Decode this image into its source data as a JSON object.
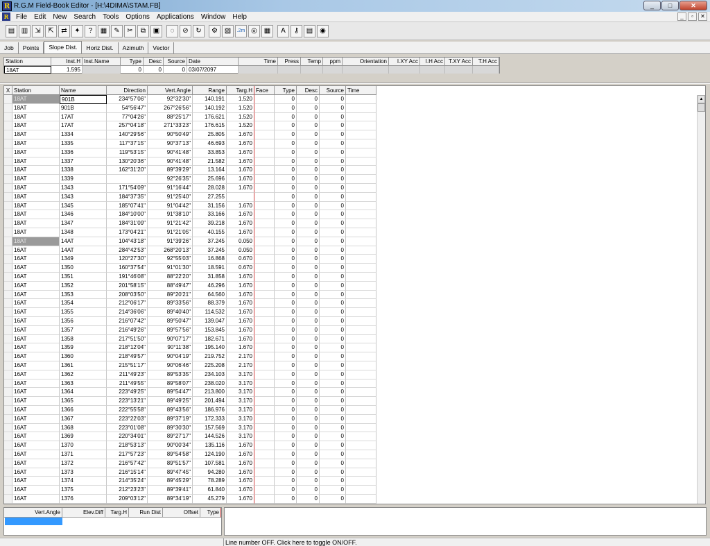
{
  "window": {
    "title": "R.G.M Field-Book Editor - [H:\\4DIMA\\STAM.FB]",
    "icon": "R",
    "min": "_",
    "max": "□",
    "close": "✕"
  },
  "menu": [
    "File",
    "Edit",
    "New",
    "Search",
    "Tools",
    "Options",
    "Applications",
    "Window",
    "Help"
  ],
  "mdi_controls": [
    "_",
    "▫",
    "✕"
  ],
  "toolbar": [
    {
      "name": "new-fieldbook-icon",
      "glyph": "▤"
    },
    {
      "name": "open-icon",
      "glyph": "▥"
    },
    {
      "name": "import-icon",
      "glyph": "⇲"
    },
    {
      "name": "export-icon",
      "glyph": "⇱"
    },
    {
      "name": "transfer-icon",
      "glyph": "⇄"
    },
    {
      "name": "run-icon",
      "glyph": "✦"
    },
    {
      "name": "query-icon",
      "glyph": "?"
    },
    {
      "name": "report-icon",
      "glyph": "▦"
    },
    {
      "name": "draw-icon",
      "glyph": "✎"
    },
    {
      "name": "cut-icon",
      "glyph": "✂"
    },
    {
      "name": "copy-icon",
      "glyph": "⧉"
    },
    {
      "name": "paste-icon",
      "glyph": "▣"
    },
    {
      "name": "disabled-1-icon",
      "glyph": "◌"
    },
    {
      "name": "cancel-icon",
      "glyph": "⊘"
    },
    {
      "name": "refresh-icon",
      "glyph": "↻"
    },
    {
      "name": "compute-icon",
      "glyph": "⚙"
    },
    {
      "name": "fieldbook-icon",
      "glyph": "▧"
    },
    {
      "name": "two-m-icon",
      "glyph": ".2m"
    },
    {
      "name": "binoculars-icon",
      "glyph": "◎"
    },
    {
      "name": "table-icon",
      "glyph": "▦"
    },
    {
      "name": "font-icon",
      "glyph": "A"
    },
    {
      "name": "key-icon",
      "glyph": "⚷"
    },
    {
      "name": "calculator-icon",
      "glyph": "▤"
    },
    {
      "name": "globe-icon",
      "glyph": "◉"
    }
  ],
  "tabs": [
    "Job",
    "Points",
    "Slope Dist.",
    "Horiz Dist.",
    "Azimuth",
    "Vector"
  ],
  "active_tab": "Slope Dist.",
  "job_grid": {
    "headers": [
      "Station",
      "Inst.H",
      "Inst.Name",
      "Type",
      "Desc",
      "Source",
      "Date",
      "Time",
      "Press",
      "Temp",
      "ppm",
      "Orientation",
      "I.XY Acc",
      "I.H Acc",
      "T.XY Acc",
      "T.H Acc"
    ],
    "row": [
      "18AT",
      "1.595",
      "",
      "0",
      "0",
      "0",
      "03/07/2097",
      "",
      "",
      "",
      "",
      "",
      "",
      "",
      "",
      ""
    ]
  },
  "main_grid": {
    "headers": [
      "X",
      "Station",
      "Name",
      "Direction",
      "Vert.Angle",
      "Range",
      "Targ.H",
      "Face",
      "Type",
      "Desc",
      "Source",
      "Time"
    ],
    "rows": [
      [
        "18AT",
        "901B",
        "234°57'06\"",
        "92°32'30\"",
        "140.191",
        "1.520",
        "0",
        "0",
        "0"
      ],
      [
        "18AT",
        "901B",
        "54°56'47\"",
        "267°26'56\"",
        "140.192",
        "1.520",
        "0",
        "0",
        "0"
      ],
      [
        "18AT",
        "17AT",
        "77°04'26\"",
        "88°25'17\"",
        "176.621",
        "1.520",
        "0",
        "0",
        "0"
      ],
      [
        "18AT",
        "17AT",
        "257°04'18\"",
        "271°33'23\"",
        "176.615",
        "1.520",
        "0",
        "0",
        "0"
      ],
      [
        "18AT",
        "1334",
        "140°29'56\"",
        "90°50'49\"",
        "25.805",
        "1.670",
        "0",
        "0",
        "0"
      ],
      [
        "18AT",
        "1335",
        "117°37'15\"",
        "90°37'13\"",
        "46.693",
        "1.670",
        "0",
        "0",
        "0"
      ],
      [
        "18AT",
        "1336",
        "119°53'15\"",
        "90°41'48\"",
        "33.853",
        "1.670",
        "0",
        "0",
        "0"
      ],
      [
        "18AT",
        "1337",
        "130°20'36\"",
        "90°41'48\"",
        "21.582",
        "1.670",
        "0",
        "0",
        "0"
      ],
      [
        "18AT",
        "1338",
        "162°31'20\"",
        "89°39'29\"",
        "13.164",
        "1.670",
        "0",
        "0",
        "0"
      ],
      [
        "18AT",
        "1339",
        "",
        "92°26'35\"",
        "25.696",
        "1.670",
        "0",
        "0",
        "0"
      ],
      [
        "18AT",
        "1343",
        "171°54'09\"",
        "91°16'44\"",
        "28.028",
        "1.670",
        "0",
        "0",
        "0"
      ],
      [
        "18AT",
        "1343",
        "184°37'35\"",
        "91°25'40\"",
        "27.255",
        "",
        "0",
        "0",
        "0"
      ],
      [
        "18AT",
        "1345",
        "185°07'41\"",
        "91°04'42\"",
        "31.156",
        "1.670",
        "0",
        "0",
        "0"
      ],
      [
        "18AT",
        "1346",
        "184°10'00\"",
        "91°38'10\"",
        "33.166",
        "1.670",
        "0",
        "0",
        "0"
      ],
      [
        "18AT",
        "1347",
        "184°31'09\"",
        "91°21'42\"",
        "39.218",
        "1.670",
        "0",
        "0",
        "0"
      ],
      [
        "18AT",
        "1348",
        "173°04'21\"",
        "91°21'05\"",
        "40.155",
        "1.670",
        "0",
        "0",
        "0"
      ],
      [
        "18AT",
        "14AT",
        "104°43'18\"",
        "91°39'26\"",
        "37.245",
        "0.050",
        "0",
        "0",
        "0"
      ],
      [
        "16AT",
        "14AT",
        "284°42'53\"",
        "268°20'13\"",
        "37.245",
        "0.050",
        "0",
        "0",
        "0"
      ],
      [
        "16AT",
        "1349",
        "120°27'30\"",
        "92°55'03\"",
        "16.868",
        "0.670",
        "0",
        "0",
        "0"
      ],
      [
        "16AT",
        "1350",
        "160°37'54\"",
        "91°01'30\"",
        "18.591",
        "0.670",
        "0",
        "0",
        "0"
      ],
      [
        "16AT",
        "1351",
        "191°46'08\"",
        "88°22'20\"",
        "31.858",
        "1.670",
        "0",
        "0",
        "0"
      ],
      [
        "16AT",
        "1352",
        "201°58'15\"",
        "88°49'47\"",
        "46.296",
        "1.670",
        "0",
        "0",
        "0"
      ],
      [
        "16AT",
        "1353",
        "208°03'50\"",
        "89°20'21\"",
        "64.560",
        "1.670",
        "0",
        "0",
        "0"
      ],
      [
        "16AT",
        "1354",
        "212°06'17\"",
        "89°33'56\"",
        "88.379",
        "1.670",
        "0",
        "0",
        "0"
      ],
      [
        "16AT",
        "1355",
        "214°36'06\"",
        "89°40'40\"",
        "114.532",
        "1.670",
        "0",
        "0",
        "0"
      ],
      [
        "16AT",
        "1356",
        "216°07'42\"",
        "89°50'47\"",
        "139.047",
        "1.670",
        "0",
        "0",
        "0"
      ],
      [
        "16AT",
        "1357",
        "216°49'26\"",
        "89°57'56\"",
        "153.845",
        "1.670",
        "0",
        "0",
        "0"
      ],
      [
        "16AT",
        "1358",
        "217°51'50\"",
        "90°07'17\"",
        "182.671",
        "1.670",
        "0",
        "0",
        "0"
      ],
      [
        "16AT",
        "1359",
        "218°12'04\"",
        "90°11'38\"",
        "195.140",
        "1.670",
        "0",
        "0",
        "0"
      ],
      [
        "16AT",
        "1360",
        "218°49'57\"",
        "90°04'19\"",
        "219.752",
        "2.170",
        "0",
        "0",
        "0"
      ],
      [
        "16AT",
        "1361",
        "215°51'17\"",
        "90°06'46\"",
        "225.208",
        "2.170",
        "0",
        "0",
        "0"
      ],
      [
        "16AT",
        "1362",
        "211°49'23\"",
        "89°53'35\"",
        "234.103",
        "3.170",
        "0",
        "0",
        "0"
      ],
      [
        "16AT",
        "1363",
        "211°49'55\"",
        "89°58'07\"",
        "238.020",
        "3.170",
        "0",
        "0",
        "0"
      ],
      [
        "16AT",
        "1364",
        "223°49'25\"",
        "89°54'47\"",
        "213.800",
        "3.170",
        "0",
        "0",
        "0"
      ],
      [
        "16AT",
        "1365",
        "223°13'21\"",
        "89°49'25\"",
        "201.494",
        "3.170",
        "0",
        "0",
        "0"
      ],
      [
        "16AT",
        "1366",
        "222°55'58\"",
        "89°43'56\"",
        "186.976",
        "3.170",
        "0",
        "0",
        "0"
      ],
      [
        "16AT",
        "1367",
        "223°22'03\"",
        "89°37'19\"",
        "172.333",
        "3.170",
        "0",
        "0",
        "0"
      ],
      [
        "16AT",
        "1368",
        "223°01'08\"",
        "89°30'30\"",
        "157.569",
        "3.170",
        "0",
        "0",
        "0"
      ],
      [
        "16AT",
        "1369",
        "220°34'01\"",
        "89°27'17\"",
        "144.526",
        "3.170",
        "0",
        "0",
        "0"
      ],
      [
        "16AT",
        "1370",
        "218°53'13\"",
        "90°00'34\"",
        "135.116",
        "1.670",
        "0",
        "0",
        "0"
      ],
      [
        "16AT",
        "1371",
        "217°57'23\"",
        "89°54'58\"",
        "124.190",
        "1.670",
        "0",
        "0",
        "0"
      ],
      [
        "16AT",
        "1372",
        "216°57'42\"",
        "89°51'57\"",
        "107.581",
        "1.670",
        "0",
        "0",
        "0"
      ],
      [
        "16AT",
        "1373",
        "216°15'14\"",
        "89°47'45\"",
        "94.280",
        "1.670",
        "0",
        "0",
        "0"
      ],
      [
        "16AT",
        "1374",
        "214°35'24\"",
        "89°45'29\"",
        "78.289",
        "1.670",
        "0",
        "0",
        "0"
      ],
      [
        "16AT",
        "1375",
        "212°23'23\"",
        "89°39'41\"",
        "61.840",
        "1.670",
        "0",
        "0",
        "0"
      ],
      [
        "16AT",
        "1376",
        "209°03'12\"",
        "89°34'19\"",
        "45.279",
        "1.670",
        "0",
        "0",
        "0"
      ]
    ]
  },
  "bottom_grid": {
    "headers": [
      "Vert.Angle",
      "Elev.Diff",
      "Targ.H",
      "Run Dist",
      "Offset",
      "Type"
    ]
  },
  "status": {
    "text": "Line number OFF. Click here to toggle ON/OFF."
  }
}
